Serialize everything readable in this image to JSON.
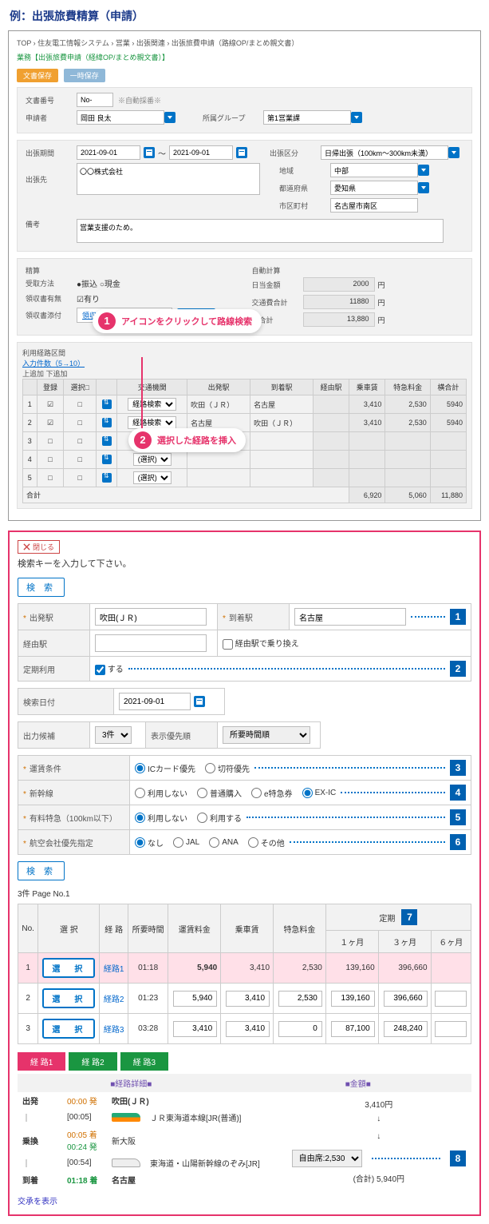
{
  "page_title": "例：出張旅費精算（申請）",
  "breadcrumb": "TOP › 住友電工情報システム › 営業 › 出張関連 › 出張旅費申請（路線OP/まとめ親文書）",
  "subtitle": "業務【出張旅費申請（経緯OP/まとめ親文書）】",
  "btn_save": "文書保存",
  "btn_temp": "一時保存",
  "f": {
    "docno_label": "文書番号",
    "docno_prefix": "No-",
    "docno_note": "※自動採番※",
    "applicant_label": "申請者",
    "applicant": "岡田 良太",
    "applicant_drop": "▾",
    "group_label": "所属グループ",
    "group": "第1営業課",
    "period_label": "出張期間",
    "period_from": "2021-09-01",
    "period_to": "2021-09-01",
    "tilde": "〜",
    "cat_label": "出張区分",
    "cat": "日帰出張（100km〜300km未満）",
    "dest_label": "出張先",
    "dest_text": "〇〇株式会社",
    "region_label": "地域",
    "region": "中部",
    "pref_label": "都道府県",
    "pref": "愛知県",
    "city_label": "市区町村",
    "city": "名古屋市南区",
    "remarks_label": "備考",
    "remarks": "営業支援のため。"
  },
  "calc": {
    "head_left": "精算",
    "head_right": "自動計算",
    "recv_label": "受取方法",
    "recv_opt1": "●振込 ○現金",
    "daily_label": "日当金額",
    "daily": "2000",
    "receipt_label": "領収書有無",
    "receipt_val": "☑有り",
    "trans_label": "交通費合計",
    "trans": "11880",
    "attach_label": "領収書添付",
    "attach_file": "領収書.pdf",
    "ref_btn": "参 照…",
    "total_label": "総合計",
    "total": "13,880",
    "yen": "円"
  },
  "seg": {
    "title": "利用経路区間",
    "rows_note": "入力件数（5→10）",
    "ctrl": "上追加 下追加",
    "h": [
      "",
      "登録",
      "選択□",
      "",
      "交通機関",
      "出発駅",
      "到着駅",
      "経由駅",
      "乗車賃",
      "特急料金",
      "横合計"
    ],
    "rows": [
      {
        "n": "1",
        "chk": "☑",
        "sel": "□",
        "mode": "経路検索",
        "dep": "吹田（ＪＲ）",
        "arr": "名古屋",
        "via": "",
        "fare": "3,410",
        "exp": "2,530",
        "tot": "5940"
      },
      {
        "n": "2",
        "chk": "☑",
        "sel": "□",
        "mode": "経路検索",
        "dep": "名古屋",
        "arr": "吹田（ＪＲ）",
        "via": "",
        "fare": "3,410",
        "exp": "2,530",
        "tot": "5940"
      },
      {
        "n": "3",
        "chk": "□",
        "sel": "□",
        "mode": "(選択)",
        "dep": "",
        "arr": "",
        "via": "",
        "fare": "",
        "exp": "",
        "tot": ""
      },
      {
        "n": "4",
        "chk": "□",
        "sel": "□",
        "mode": "(選択)",
        "dep": "",
        "arr": "",
        "via": "",
        "fare": "",
        "exp": "",
        "tot": ""
      },
      {
        "n": "5",
        "chk": "□",
        "sel": "□",
        "mode": "(選択)",
        "dep": "",
        "arr": "",
        "via": "",
        "fare": "",
        "exp": "",
        "tot": ""
      }
    ],
    "sum_label": "合計",
    "sum_fare": "6,920",
    "sum_exp": "5,060",
    "sum_tot": "11,880"
  },
  "call1": "アイコンをクリックして路線検索",
  "call2": "選択した経路を挿入",
  "sp": {
    "close": "閉じる",
    "prompt": "検索キーを入力して下さい。",
    "search_btn": "検 索",
    "dep_label": "出発駅",
    "dep": "吹田(ＪＲ)",
    "arr_label": "到着駅",
    "arr": "名古屋",
    "via_label": "経由駅",
    "via_chk": "経由駅で乗り換え",
    "pass_label": "定期利用",
    "pass_chk": "する",
    "date_label": "検索日付",
    "date": "2021-09-01",
    "cand_label": "出力候補",
    "cand": "3件",
    "ord_label": "表示優先順",
    "ord": "所要時間順",
    "fare_cond": "運賃条件",
    "fare_o1": "ICカード優先",
    "fare_o2": "切符優先",
    "shink": "新幹線",
    "sh_o1": "利用しない",
    "sh_o2": "普通購入",
    "sh_o3": "e特急券",
    "sh_o4": "EX-IC",
    "ltd": "有料特急（100km以下）",
    "ltd_o1": "利用しない",
    "ltd_o2": "利用する",
    "air": "航空会社優先指定",
    "air_o1": "なし",
    "air_o2": "JAL",
    "air_o3": "ANA",
    "air_o4": "その他",
    "count": "3件 Page No.1",
    "rh": [
      "No.",
      "選 択",
      "経 路",
      "所要時間",
      "運賃料金",
      "乗車賃",
      "特急料金"
    ],
    "rh_teiki": "定期",
    "rh_teiki_sub": [
      "１ヶ月",
      "３ヶ月",
      "６ヶ月"
    ],
    "rrows": [
      {
        "n": "1",
        "r": "経路1",
        "t": "01:18",
        "fare": "5,940",
        "ride": "3,410",
        "exp": "2,530",
        "m1": "139,160",
        "m3": "396,660",
        "m6": ""
      },
      {
        "n": "2",
        "r": "経路2",
        "t": "01:23",
        "fare": "5,940",
        "ride": "3,410",
        "exp": "2,530",
        "m1": "139,160",
        "m3": "396,660",
        "m6": ""
      },
      {
        "n": "3",
        "r": "経路3",
        "t": "03:28",
        "fare": "3,410",
        "ride": "3,410",
        "exp": "0",
        "m1": "87,100",
        "m3": "248,240",
        "m6": ""
      }
    ],
    "pick": "選　択",
    "tabs": [
      "経 路1",
      "経 路2",
      "経 路3"
    ],
    "dh1": "■経路詳細■",
    "dh2": "■金額■",
    "d": {
      "dep_l": "出発",
      "dep_t": "00:00 発",
      "dep_s": "吹田(ＪＲ)",
      "dep_amt": "3,410円",
      "seg1_t": "[00:05]",
      "seg1": "ＪＲ東海道本線[JR(普通)]",
      "seg1_amt": "↓",
      "chg_l": "乗換",
      "chg_t1": "00:05 着",
      "chg_t2": "00:24 発",
      "chg_s": "新大阪",
      "chg_amt": "↓",
      "seg2_t": "[00:54]",
      "seg2": "東海道・山陽新幹線のぞみ[JR]",
      "seg2_seat": "自由席:2,530",
      "arr_l": "到着",
      "arr_t": "01:18 着",
      "arr_s": "名古屋",
      "tot": "(合計) 5,940円"
    },
    "footer": "交承を表示"
  },
  "tags": {
    "1": "1",
    "2": "2",
    "3": "3",
    "4": "4",
    "5": "5",
    "6": "6",
    "7": "7",
    "8": "8"
  }
}
